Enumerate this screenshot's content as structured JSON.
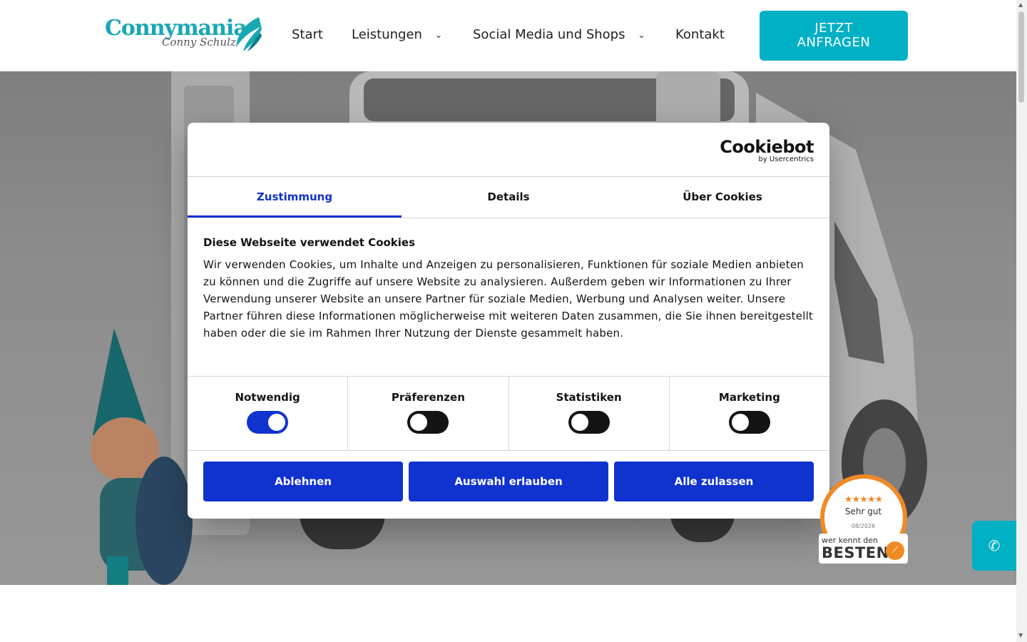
{
  "header": {
    "logo": {
      "title": "Connymania",
      "subtitle": "Conny Schulz"
    },
    "nav": [
      {
        "label": "Start",
        "has_dropdown": false
      },
      {
        "label": "Leistungen",
        "has_dropdown": true
      },
      {
        "label": "Social Media und Shops",
        "has_dropdown": true
      },
      {
        "label": "Kontakt",
        "has_dropdown": false
      }
    ],
    "cta": {
      "line1": "JETZT",
      "line2": "ANFRAGEN"
    }
  },
  "cookie_dialog": {
    "brand": {
      "name": "Cookiebot",
      "byline": "by Usercentrics"
    },
    "tabs": [
      {
        "label": "Zustimmung",
        "active": true
      },
      {
        "label": "Details",
        "active": false
      },
      {
        "label": "Über Cookies",
        "active": false
      }
    ],
    "heading": "Diese Webseite verwendet Cookies",
    "body": "Wir verwenden Cookies, um Inhalte und Anzeigen zu personalisieren, Funktionen für soziale Medien anbieten zu können und die Zugriffe auf unsere Website zu analysieren. Außerdem geben wir Informationen zu Ihrer Verwendung unserer Website an unsere Partner für soziale Medien, Werbung und Analysen weiter. Unsere Partner führen diese Informationen möglicherweise mit weiteren Daten zusammen, die Sie ihnen bereitgestellt haben oder die sie im Rahmen Ihrer Nutzung der Dienste gesammelt haben.",
    "toggles": [
      {
        "label": "Notwendig",
        "on": true
      },
      {
        "label": "Präferenzen",
        "on": false
      },
      {
        "label": "Statistiken",
        "on": false
      },
      {
        "label": "Marketing",
        "on": false
      }
    ],
    "buttons": {
      "decline": "Ablehnen",
      "allow_selection": "Auswahl erlauben",
      "allow_all": "Alle zulassen"
    }
  },
  "badge": {
    "stars": "★★★★★",
    "rating": "Sehr gut",
    "date": "08/2026",
    "small": "wer kennt den",
    "big": "BESTEN"
  },
  "colors": {
    "accent": "#00b0c4",
    "cookie_blue": "#1032cf",
    "badge_orange": "#f08a24"
  },
  "icons": {
    "chat": "whatsapp-icon",
    "dropdown": "chevron-down-icon"
  }
}
